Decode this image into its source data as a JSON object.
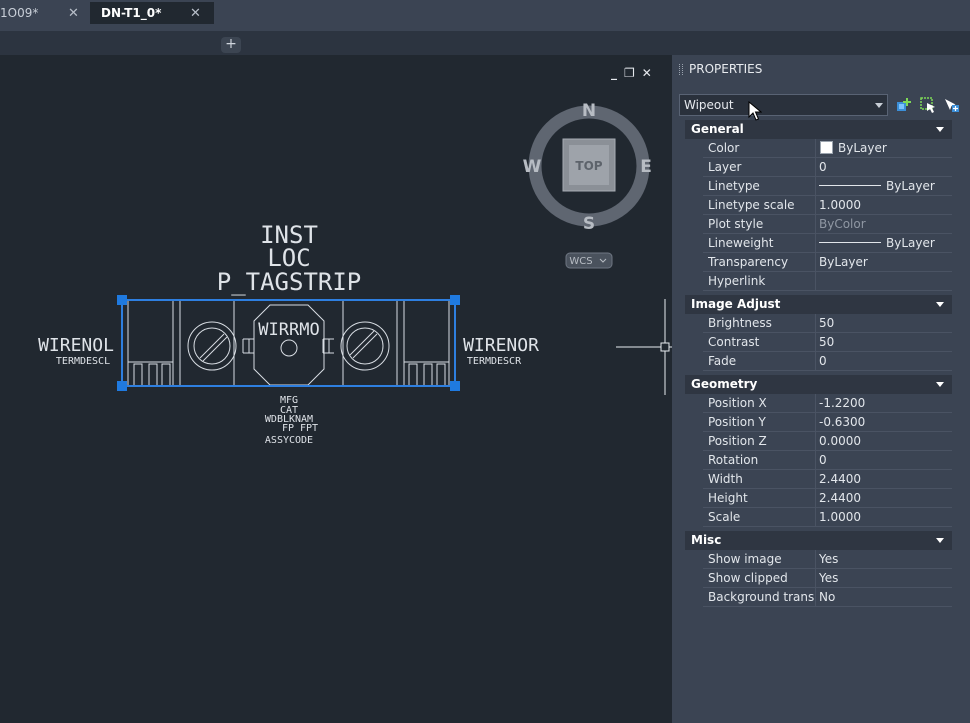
{
  "tabs": [
    {
      "label": "1O09*",
      "active": false
    },
    {
      "label": "DN-T1_0*",
      "active": true
    }
  ],
  "tab_add_label": "+",
  "viewport_controls": {
    "minimize": "_",
    "restore": "❐",
    "close": "✕"
  },
  "viewcube": {
    "face": "TOP",
    "north": "N",
    "south": "S",
    "east": "E",
    "west": "W",
    "ucs": "WCS"
  },
  "drawing": {
    "inst": "INST",
    "loc": "LOC",
    "tagstrip": "P_TAGSTRIP",
    "wire_left": "WIRENOL",
    "desc_left": "TERMDESCL",
    "wire_mid": "WIRRMO",
    "wire_right": "WIRENOR",
    "desc_right": "TERMDESCR",
    "mfg": "MFG",
    "cat": "CAT",
    "wdblknam": "WDBLKNAM",
    "fpfpt": "FP FPT",
    "assycode": "ASSYCODE"
  },
  "panel": {
    "title": "PROPERTIES",
    "selected_object": "Wipeout",
    "sections": [
      {
        "name": "General",
        "rows": [
          {
            "label": "Color",
            "value": "ByLayer",
            "kind": "swatch"
          },
          {
            "label": "Layer",
            "value": "0"
          },
          {
            "label": "Linetype",
            "value": "ByLayer",
            "kind": "line"
          },
          {
            "label": "Linetype scale",
            "value": "1.0000"
          },
          {
            "label": "Plot style",
            "value": "ByColor",
            "kind": "dim"
          },
          {
            "label": "Lineweight",
            "value": "ByLayer",
            "kind": "line"
          },
          {
            "label": "Transparency",
            "value": "ByLayer"
          },
          {
            "label": "Hyperlink",
            "value": ""
          }
        ]
      },
      {
        "name": "Image Adjust",
        "rows": [
          {
            "label": "Brightness",
            "value": "50"
          },
          {
            "label": "Contrast",
            "value": "50"
          },
          {
            "label": "Fade",
            "value": "0"
          }
        ]
      },
      {
        "name": "Geometry",
        "rows": [
          {
            "label": "Position X",
            "value": "-1.2200"
          },
          {
            "label": "Position Y",
            "value": "-0.6300"
          },
          {
            "label": "Position Z",
            "value": "0.0000"
          },
          {
            "label": "Rotation",
            "value": "0"
          },
          {
            "label": "Width",
            "value": "2.4400"
          },
          {
            "label": "Height",
            "value": "2.4400"
          },
          {
            "label": "Scale",
            "value": "1.0000"
          }
        ]
      },
      {
        "name": "Misc",
        "rows": [
          {
            "label": "Show image",
            "value": "Yes"
          },
          {
            "label": "Show clipped",
            "value": "Yes"
          },
          {
            "label": "Background trans...",
            "value": "No"
          }
        ]
      }
    ]
  },
  "colors": {
    "background": "#212830",
    "panel": "#3b4453",
    "selection": "#1f7ae0",
    "drawing_line": "#d8dde3"
  },
  "icons": [
    "quick-select-icon",
    "select-objects-icon",
    "toggle-pickadd-icon",
    "cursor-icon"
  ]
}
